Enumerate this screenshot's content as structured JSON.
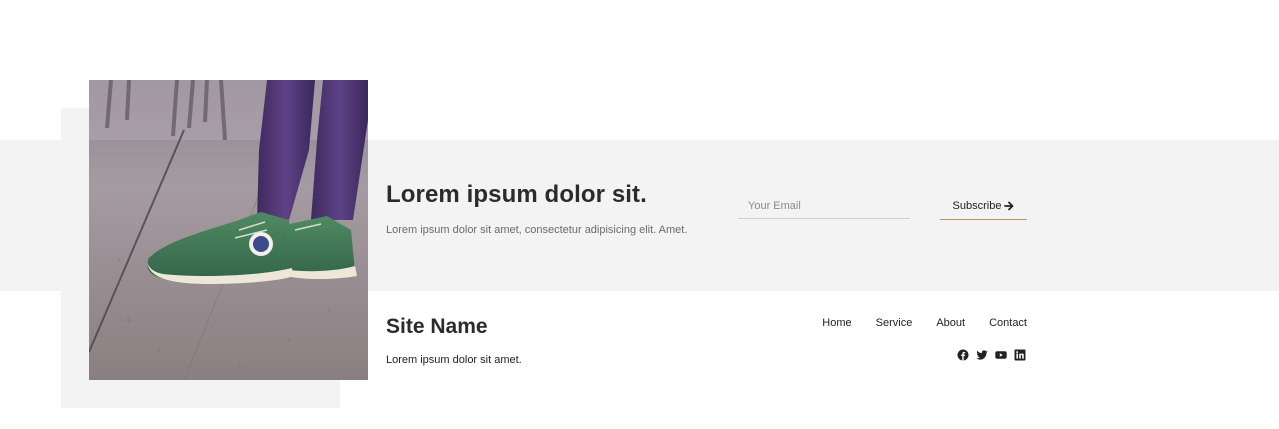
{
  "newsletter": {
    "headline": "Lorem ipsum dolor sit.",
    "subtext": "Lorem ipsum dolor sit amet, consectetur adipisicing elit. Amet.",
    "email_placeholder": "Your Email",
    "subscribe_label": "Subscribe"
  },
  "footer": {
    "site_name": "Site Name",
    "tagline": "Lorem ipsum dolor sit amet.",
    "nav": [
      "Home",
      "Service",
      "About",
      "Contact"
    ],
    "social_icons": [
      "facebook-icon",
      "twitter-icon",
      "youtube-icon",
      "linkedin-icon"
    ]
  },
  "colors": {
    "band_background": "#f3f3f3",
    "subscribe_underline": "#b59b52",
    "text_dark": "#2b2b2b"
  }
}
